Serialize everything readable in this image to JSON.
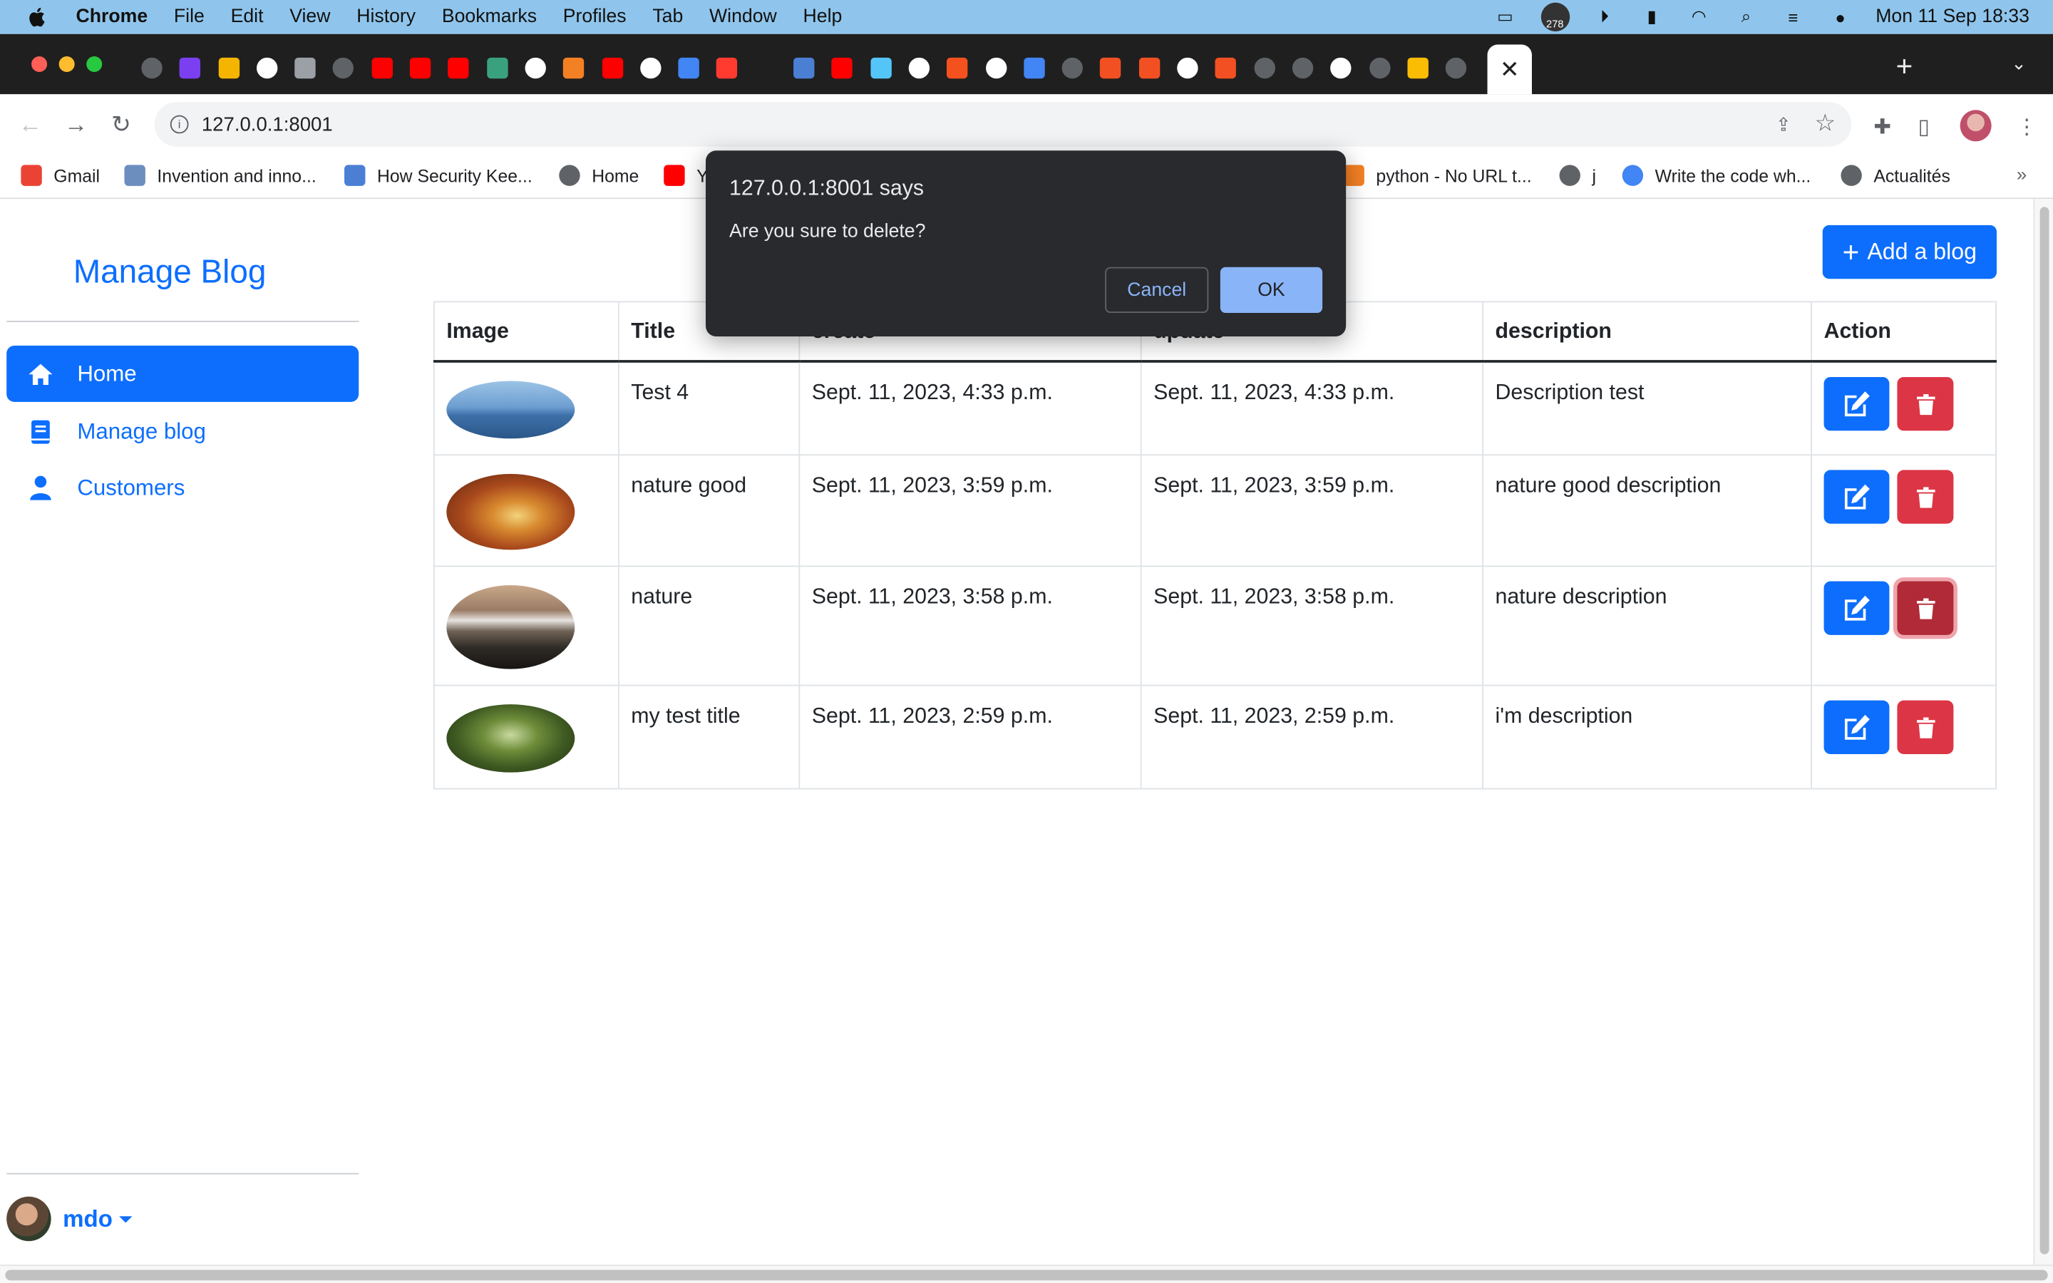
{
  "menubar": {
    "app": "Chrome",
    "items": [
      "File",
      "Edit",
      "View",
      "History",
      "Bookmarks",
      "Profiles",
      "Tab",
      "Window",
      "Help"
    ],
    "badge": "278",
    "clock": "Mon 11 Sep  18:33"
  },
  "toolbar": {
    "url": "127.0.0.1:8001"
  },
  "bookmarks": [
    {
      "label": "Gmail",
      "color": "#ea4335"
    },
    {
      "label": "Invention and inno...",
      "color": "#6c8ebf"
    },
    {
      "label": "How Security Kee...",
      "color": "#4a7fd4"
    },
    {
      "label": "Home",
      "color": "#5f6368"
    },
    {
      "label": "Y",
      "color": "#ff0000"
    },
    {
      "label": "python - No URL t...",
      "color": "#f48024"
    },
    {
      "label": "j",
      "color": "#5f6368"
    },
    {
      "label": "Write the code wh...",
      "color": "#4285f4"
    },
    {
      "label": "Actualités",
      "color": "#5f6368"
    }
  ],
  "sidebar": {
    "title": "Manage Blog",
    "items": [
      {
        "label": "Home",
        "icon": "home-icon"
      },
      {
        "label": "Manage blog",
        "icon": "book-icon"
      },
      {
        "label": "Customers",
        "icon": "person-icon"
      }
    ],
    "user": "mdo"
  },
  "main": {
    "add_button": "Add a blog",
    "columns": [
      "Image",
      "Title",
      "create",
      "update",
      "description",
      "Action"
    ],
    "rows": [
      {
        "title": "Test 4",
        "create": "Sept. 11, 2023, 4:33 p.m.",
        "update": "Sept. 11, 2023, 4:33 p.m.",
        "description": "Description test"
      },
      {
        "title": "nature good",
        "create": "Sept. 11, 2023, 3:59 p.m.",
        "update": "Sept. 11, 2023, 3:59 p.m.",
        "description": "nature good description"
      },
      {
        "title": "nature",
        "create": "Sept. 11, 2023, 3:58 p.m.",
        "update": "Sept. 11, 2023, 3:58 p.m.",
        "description": "nature description"
      },
      {
        "title": "my test title",
        "create": "Sept. 11, 2023, 2:59 p.m.",
        "update": "Sept. 11, 2023, 2:59 p.m.",
        "description": "i'm description"
      }
    ]
  },
  "dialog": {
    "title": "127.0.0.1:8001 says",
    "message": "Are you sure to delete?",
    "cancel": "Cancel",
    "ok": "OK"
  },
  "colors": {
    "primary": "#0d6efd",
    "danger": "#dc3545",
    "dialog_bg": "#292a2d",
    "dialog_accent": "#8ab4f8"
  }
}
